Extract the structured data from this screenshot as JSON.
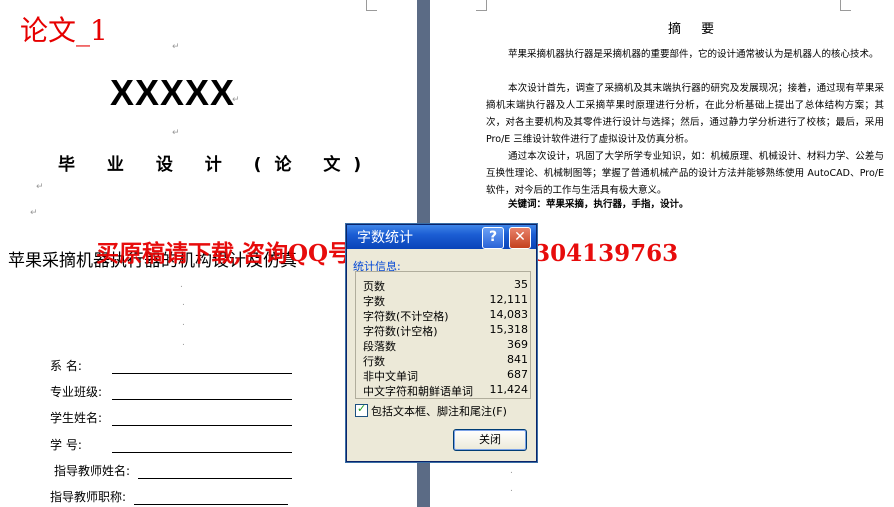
{
  "left_page": {
    "thesis_label": "论文_1",
    "school_name": "XXXXX",
    "doc_type": "毕 业 设 计 (论 文)",
    "thesis_title": "苹果采摘机器执行器的机构设计及仿真",
    "fields": [
      {
        "label": "系    名:"
      },
      {
        "label": "专业班级:"
      },
      {
        "label": "学生姓名:"
      },
      {
        "label": "学    号:"
      },
      {
        "label": "指导教师姓名:"
      },
      {
        "label": "指导教师职称:"
      }
    ]
  },
  "watermark": "买原稿请下载,咨询QQ号414951605或1304139763",
  "right_page": {
    "abstract_heading": "摘 要",
    "paragraphs": [
      "苹果采摘机器执行器是采摘机器的重要部件，它的设计通常被认为是机器人的核心技术。",
      "本次设计首先，调查了采摘机及其末端执行器的研究及发展现况；接着，通过现有苹果采摘机末端执行器及人工采摘苹果时原理进行分析，在此分析基础上提出了总体结构方案；其次，对各主要机构及其零件进行设计与选择；然后，通过静力学分析进行了校核；最后，采用 Pro/E 三维设计软件进行了虚拟设计及仿真分析。",
      "通过本次设计，巩固了大学所学专业知识，如：机械原理、机械设计、材料力学、公差与互换性理论、机械制图等；掌握了普通机械产品的设计方法并能够熟练使用 AutoCAD、Pro/E 软件，对今后的工作与生活具有极大意义。",
      "关键词：苹果采摘，执行器，手指，设计。"
    ]
  },
  "dialog": {
    "title": "字数统计",
    "help_label": "?",
    "close_x": "✕",
    "stats_header": "统计信息:",
    "stats": [
      {
        "label": "页数",
        "value": "35"
      },
      {
        "label": "字数",
        "value": "12,111"
      },
      {
        "label": "字符数(不计空格)",
        "value": "14,083"
      },
      {
        "label": "字符数(计空格)",
        "value": "15,318"
      },
      {
        "label": "段落数",
        "value": "369"
      },
      {
        "label": "行数",
        "value": "841"
      },
      {
        "label": "非中文单词",
        "value": "687"
      },
      {
        "label": "中文字符和朝鲜语单词",
        "value": "11,424"
      }
    ],
    "include_label": "包括文本框、脚注和尾注(F)",
    "close_label": "关闭"
  }
}
